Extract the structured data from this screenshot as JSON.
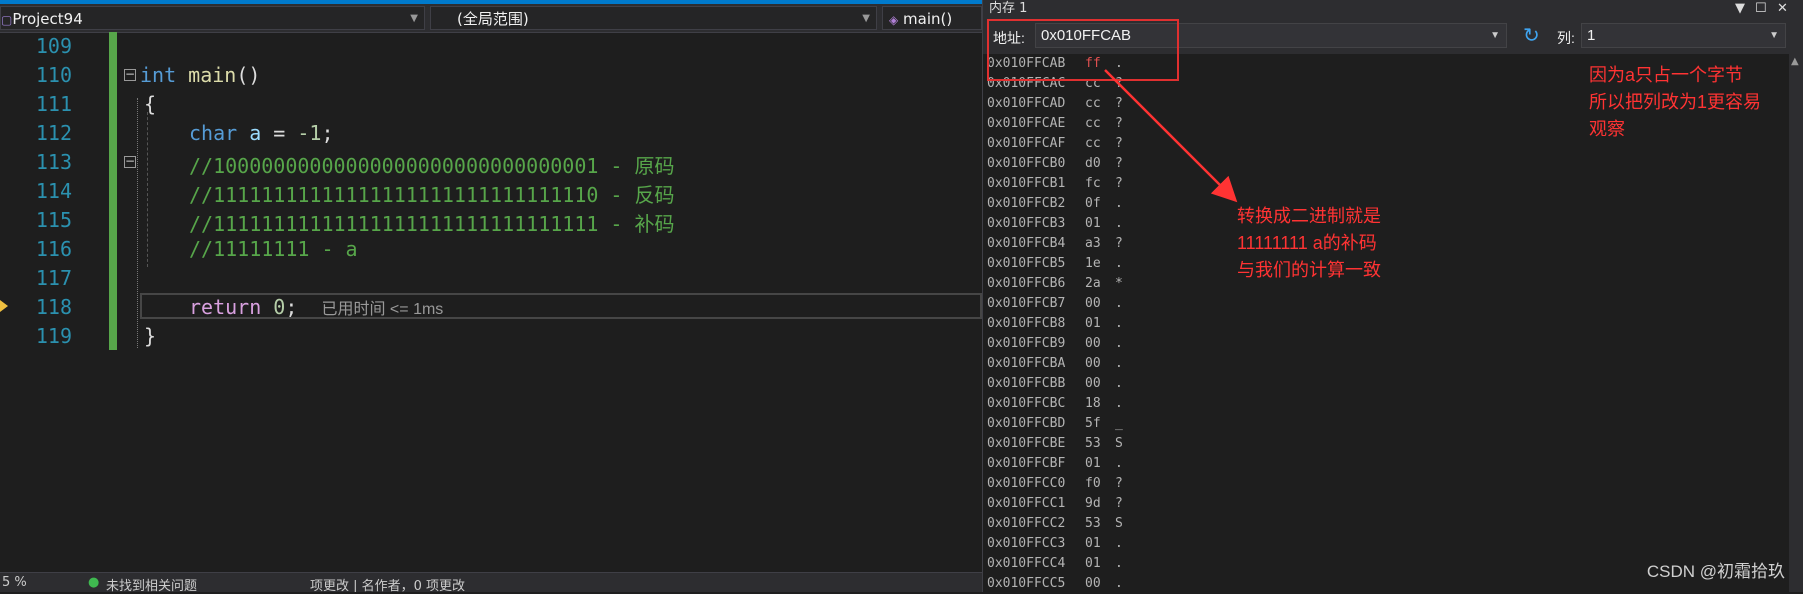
{
  "editor": {
    "nav": {
      "project": "Project94",
      "scope": "(全局范围)",
      "function": "main()"
    },
    "line_numbers": [
      "109",
      "110",
      "111",
      "112",
      "113",
      "114",
      "115",
      "116",
      "117",
      "118",
      "119"
    ],
    "code": {
      "l110_kw": "int",
      "l110_fn": "main",
      "l110_rest": "()",
      "l111": "{",
      "l112_kw": "char",
      "l112_id": "a",
      "l112_eq": " = ",
      "l112_num": "-1",
      "l112_end": ";",
      "l113": "//10000000000000000000000000000001 - 原码",
      "l114": "//11111111111111111111111111111110 - 反码",
      "l115": "//11111111111111111111111111111111 - 补码",
      "l116": "//11111111 - a",
      "l118_kw": "return",
      "l118_num": "0",
      "l118_end": ";",
      "l119": "}"
    },
    "timing": "已用时间 <= 1ms",
    "status": {
      "zoom": "5 %",
      "issues": "未找到相关问题",
      "tabs": "项更改 | 名作者，0 项更改"
    }
  },
  "memory": {
    "title": "内存 1",
    "address_label": "地址:",
    "address_value": "0x010FFCAB",
    "columns_label": "列:",
    "columns_value": "1",
    "rows": [
      {
        "addr": "0x010FFCAB",
        "hex": "ff",
        "chr": "."
      },
      {
        "addr": "0x010FFCAC",
        "hex": "cc",
        "chr": "?"
      },
      {
        "addr": "0x010FFCAD",
        "hex": "cc",
        "chr": "?"
      },
      {
        "addr": "0x010FFCAE",
        "hex": "cc",
        "chr": "?"
      },
      {
        "addr": "0x010FFCAF",
        "hex": "cc",
        "chr": "?"
      },
      {
        "addr": "0x010FFCB0",
        "hex": "d0",
        "chr": "?"
      },
      {
        "addr": "0x010FFCB1",
        "hex": "fc",
        "chr": "?"
      },
      {
        "addr": "0x010FFCB2",
        "hex": "0f",
        "chr": "."
      },
      {
        "addr": "0x010FFCB3",
        "hex": "01",
        "chr": "."
      },
      {
        "addr": "0x010FFCB4",
        "hex": "a3",
        "chr": "?"
      },
      {
        "addr": "0x010FFCB5",
        "hex": "1e",
        "chr": "."
      },
      {
        "addr": "0x010FFCB6",
        "hex": "2a",
        "chr": "*"
      },
      {
        "addr": "0x010FFCB7",
        "hex": "00",
        "chr": "."
      },
      {
        "addr": "0x010FFCB8",
        "hex": "01",
        "chr": "."
      },
      {
        "addr": "0x010FFCB9",
        "hex": "00",
        "chr": "."
      },
      {
        "addr": "0x010FFCBA",
        "hex": "00",
        "chr": "."
      },
      {
        "addr": "0x010FFCBB",
        "hex": "00",
        "chr": "."
      },
      {
        "addr": "0x010FFCBC",
        "hex": "18",
        "chr": "."
      },
      {
        "addr": "0x010FFCBD",
        "hex": "5f",
        "chr": "_"
      },
      {
        "addr": "0x010FFCBE",
        "hex": "53",
        "chr": "S"
      },
      {
        "addr": "0x010FFCBF",
        "hex": "01",
        "chr": "."
      },
      {
        "addr": "0x010FFCC0",
        "hex": "f0",
        "chr": "?"
      },
      {
        "addr": "0x010FFCC1",
        "hex": "9d",
        "chr": "?"
      },
      {
        "addr": "0x010FFCC2",
        "hex": "53",
        "chr": "S"
      },
      {
        "addr": "0x010FFCC3",
        "hex": "01",
        "chr": "."
      },
      {
        "addr": "0x010FFCC4",
        "hex": "01",
        "chr": "."
      },
      {
        "addr": "0x010FFCC5",
        "hex": "00",
        "chr": "."
      }
    ]
  },
  "annotations": {
    "note_right": [
      "因为a只占一个字节",
      "所以把列改为1更容易",
      "观察"
    ],
    "note_middle": [
      "转换成二进制就是",
      "11111111 a的补码",
      "与我们的计算一致"
    ]
  },
  "watermark": "CSDN @初霜拾玖",
  "colors": {
    "accent": "#007acc",
    "annotation": "#ff3333",
    "changed_byte": "#e05050"
  }
}
